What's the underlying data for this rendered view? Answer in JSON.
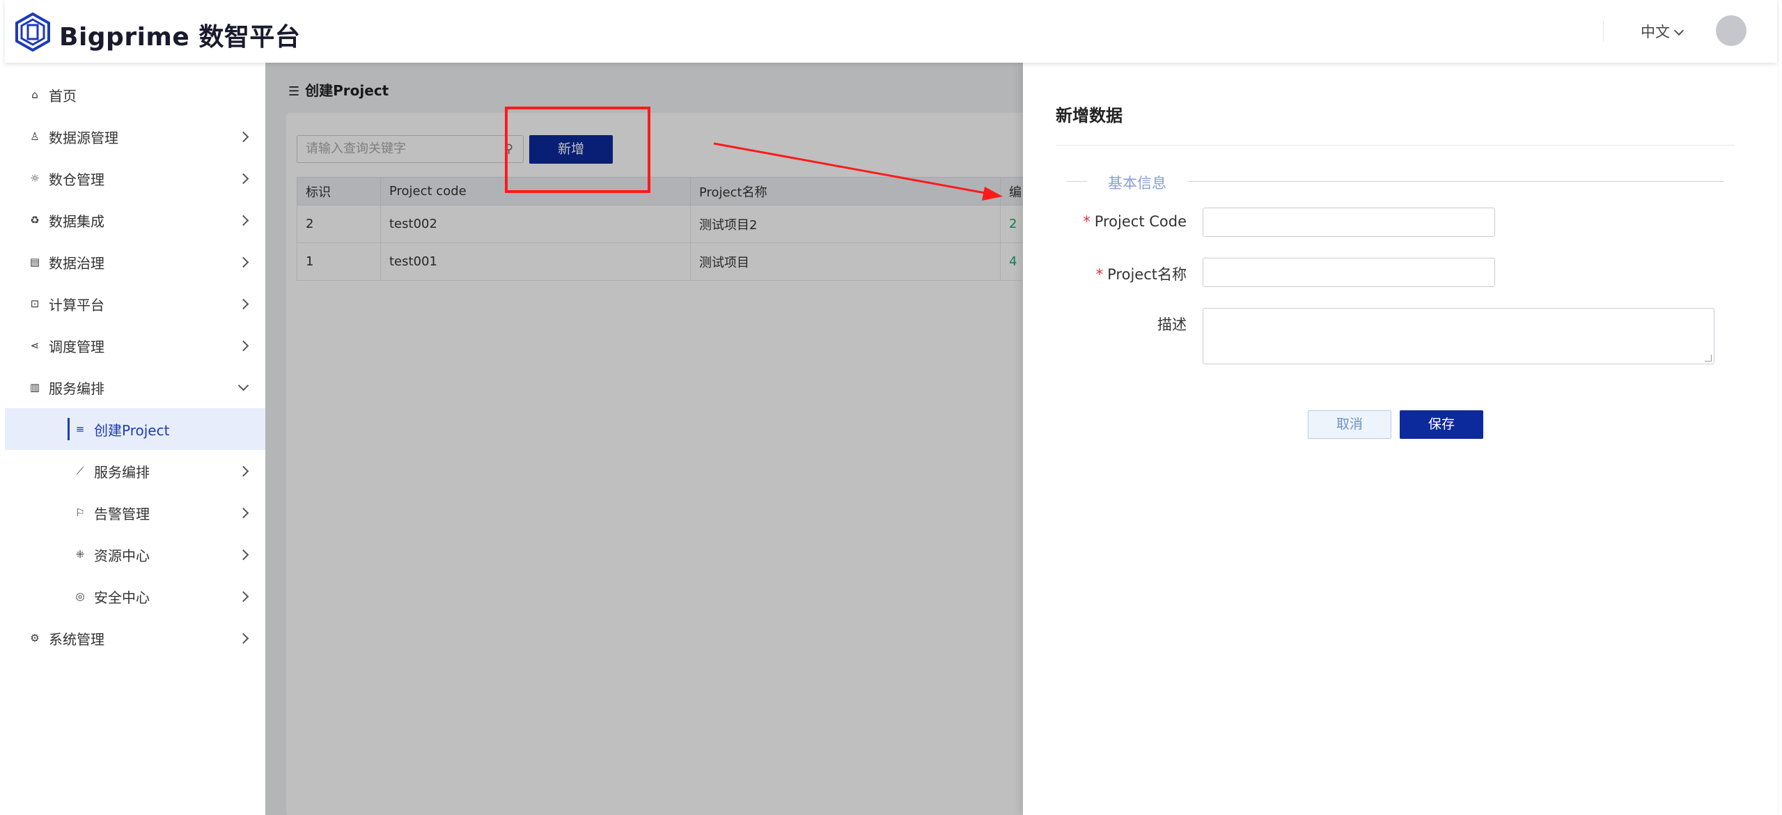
{
  "header": {
    "app_title": "Bigprime 数智平台",
    "language": "中文",
    "brand_color": "#1d3bb8"
  },
  "sidebar": {
    "items": [
      {
        "label": "首页",
        "icon": "home-icon"
      },
      {
        "label": "数据源管理",
        "icon": "database-icon"
      },
      {
        "label": "数仓管理",
        "icon": "warehouse-icon"
      },
      {
        "label": "数据集成",
        "icon": "integration-icon"
      },
      {
        "label": "数据治理",
        "icon": "governance-icon"
      },
      {
        "label": "计算平台",
        "icon": "compute-icon"
      },
      {
        "label": "调度管理",
        "icon": "schedule-icon"
      },
      {
        "label": "服务编排",
        "icon": "chart-icon",
        "expanded": true
      },
      {
        "label": "创建Project",
        "icon": "list-icon",
        "active": true
      },
      {
        "label": "服务编排",
        "icon": "line-chart-icon"
      },
      {
        "label": "告警管理",
        "icon": "flag-icon"
      },
      {
        "label": "资源中心",
        "icon": "resource-icon"
      },
      {
        "label": "安全中心",
        "icon": "shield-icon"
      },
      {
        "label": "系统管理",
        "icon": "gear-icon"
      }
    ]
  },
  "main": {
    "page_title": "创建Project",
    "search_placeholder": "请输入查询关键字",
    "add_button": "新增",
    "table": {
      "columns": [
        "标识",
        "Project code",
        "Project名称",
        "编"
      ],
      "rows": [
        [
          "2",
          "test002",
          "测试项目2",
          "2"
        ],
        [
          "1",
          "test001",
          "测试项目",
          "4"
        ]
      ]
    }
  },
  "drawer": {
    "title": "新增数据",
    "section": "基本信息",
    "fields": [
      {
        "label": "Project Code",
        "required": true,
        "value": ""
      },
      {
        "label": "Project名称",
        "required": true,
        "value": ""
      },
      {
        "label": "描述",
        "required": false,
        "value": ""
      }
    ],
    "cancel_button": "取消",
    "save_button": "保存"
  }
}
